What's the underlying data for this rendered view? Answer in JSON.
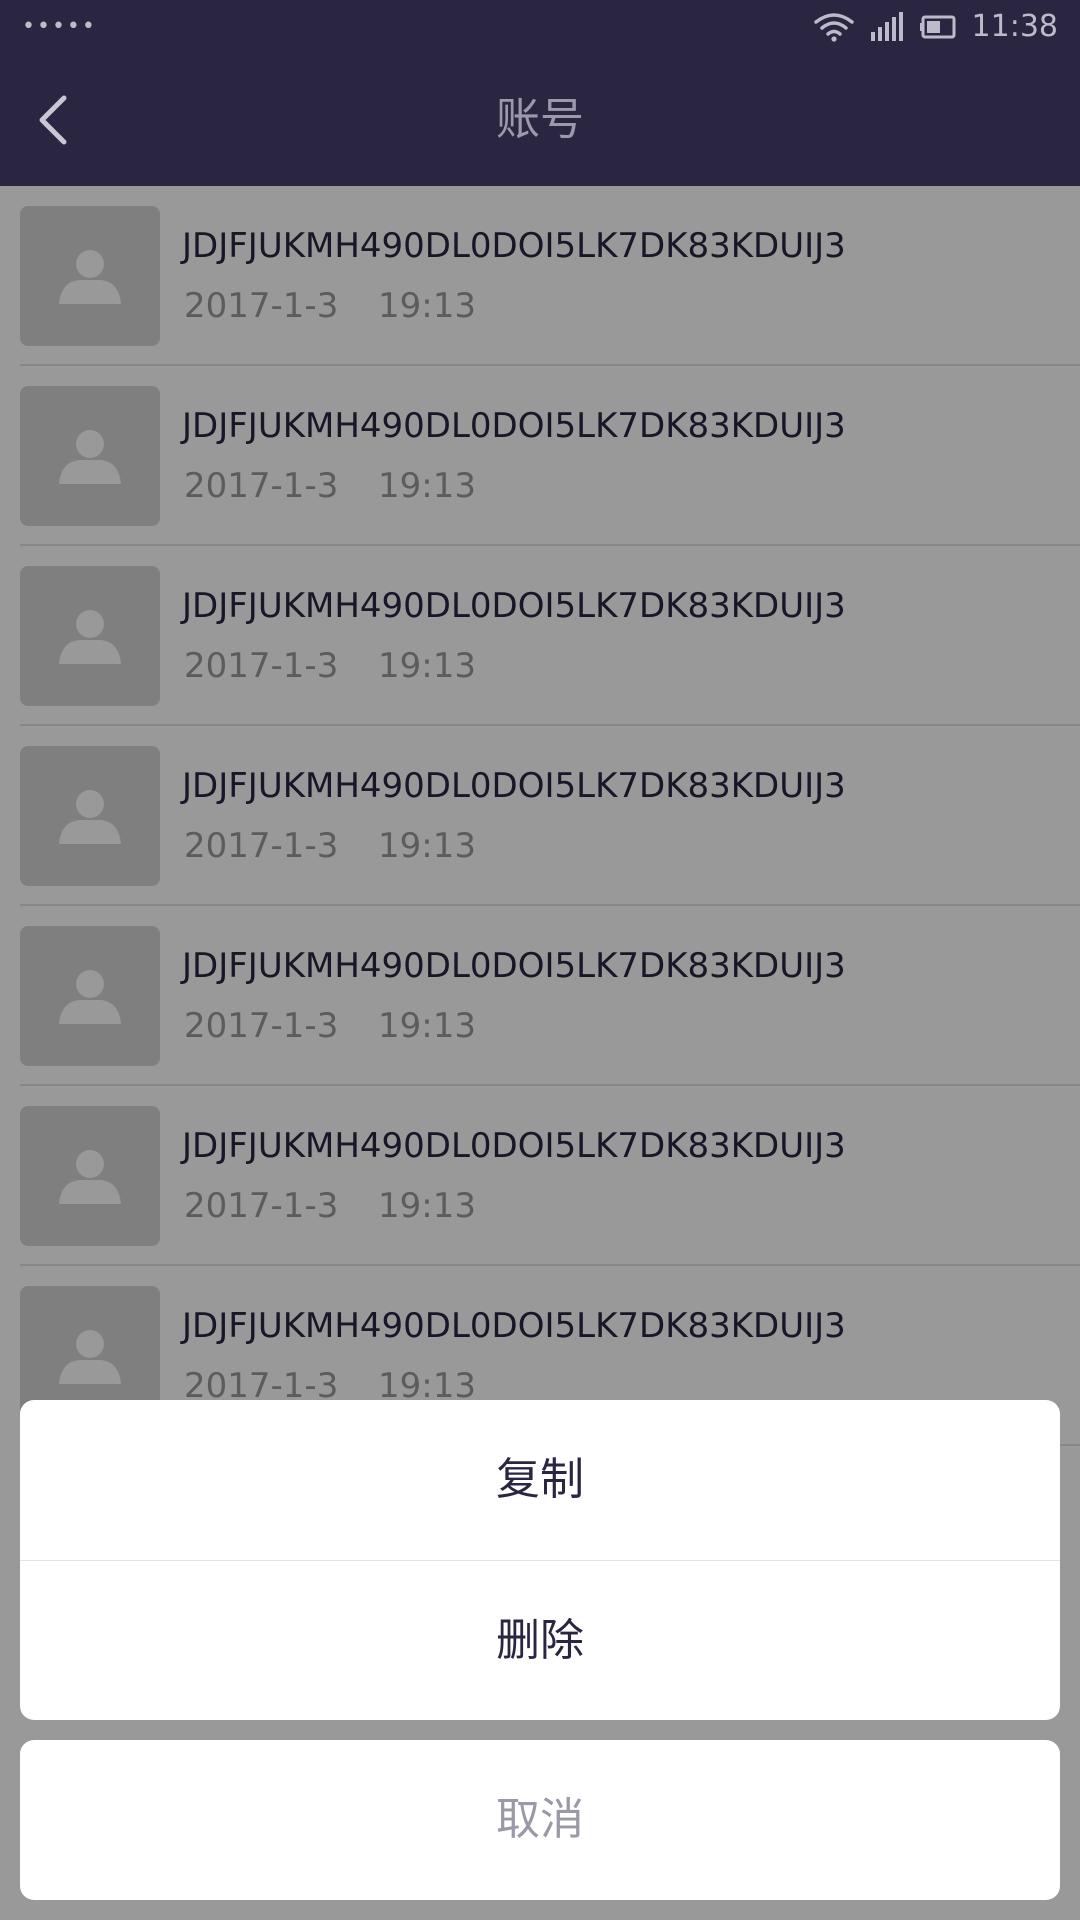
{
  "status_bar": {
    "signal_dots": "•••••",
    "time": "11:38",
    "icons": [
      "wifi-icon",
      "cellular-signal-icon",
      "battery-icon"
    ]
  },
  "header": {
    "title": "账号",
    "back_icon": "chevron-left-icon"
  },
  "accounts": [
    {
      "id": "JDJFJUKMH490DL0DOI5LK7DK83KDUIJ3",
      "date": "2017-1-3",
      "time": "19:13"
    },
    {
      "id": "JDJFJUKMH490DL0DOI5LK7DK83KDUIJ3",
      "date": "2017-1-3",
      "time": "19:13"
    },
    {
      "id": "JDJFJUKMH490DL0DOI5LK7DK83KDUIJ3",
      "date": "2017-1-3",
      "time": "19:13"
    },
    {
      "id": "JDJFJUKMH490DL0DOI5LK7DK83KDUIJ3",
      "date": "2017-1-3",
      "time": "19:13"
    },
    {
      "id": "JDJFJUKMH490DL0DOI5LK7DK83KDUIJ3",
      "date": "2017-1-3",
      "time": "19:13"
    },
    {
      "id": "JDJFJUKMH490DL0DOI5LK7DK83KDUIJ3",
      "date": "2017-1-3",
      "time": "19:13"
    },
    {
      "id": "JDJFJUKMH490DL0DOI5LK7DK83KDUIJ3",
      "date": "2017-1-3",
      "time": "19:13"
    }
  ],
  "action_sheet": {
    "copy_label": "复制",
    "delete_label": "删除",
    "cancel_label": "取消"
  },
  "colors": {
    "header_bg": "#2a2642",
    "title_text": "#9c99ad",
    "primary_text": "#2a2642",
    "secondary_text": "#9a9a9a",
    "avatar_bg": "#d4d4d6"
  }
}
